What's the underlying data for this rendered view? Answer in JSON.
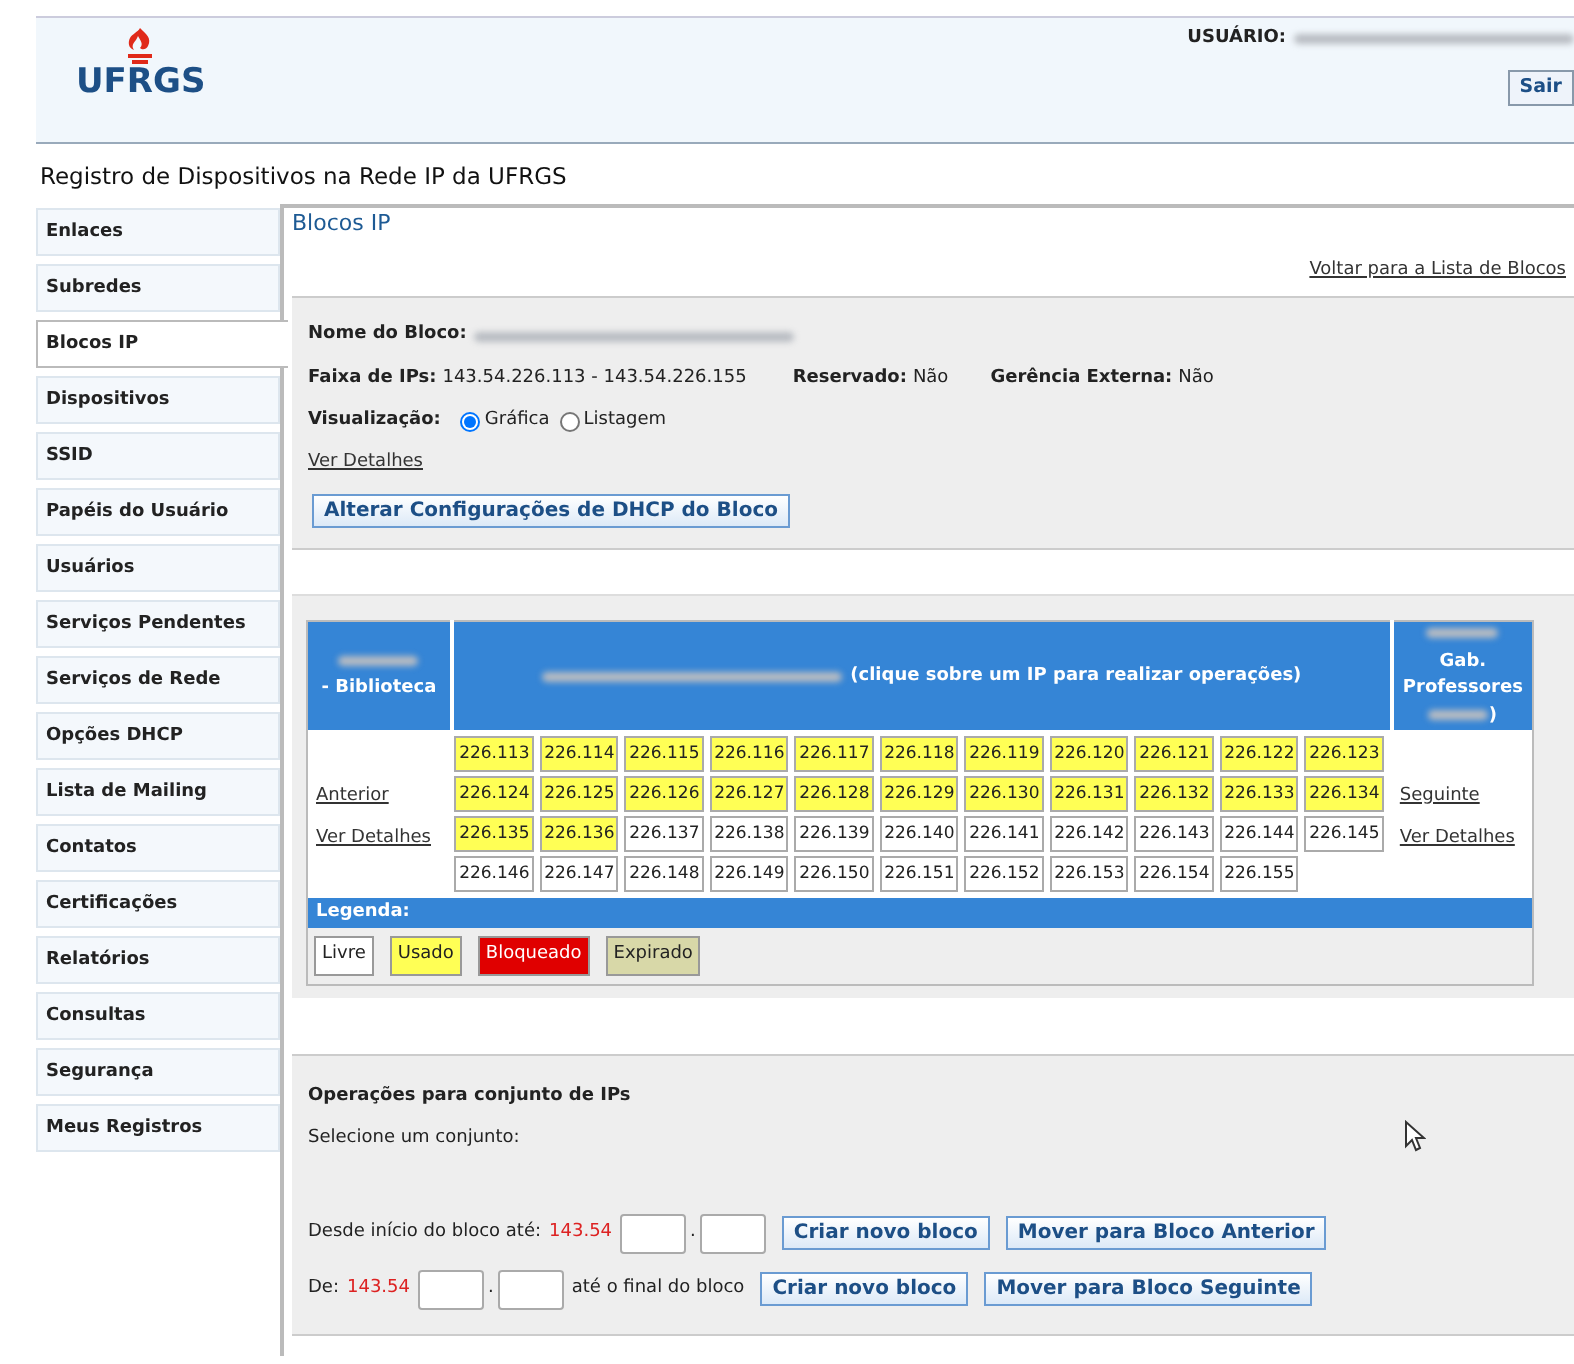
{
  "header": {
    "logo": "UFRGS",
    "user_label": "USUÁRIO:",
    "logout": "Sair"
  },
  "page_title": "Registro de Dispositivos na Rede IP da UFRGS",
  "sidebar": {
    "items": [
      {
        "label": "Enlaces",
        "selected": false
      },
      {
        "label": "Subredes",
        "selected": false
      },
      {
        "label": "Blocos IP",
        "selected": true
      },
      {
        "label": "Dispositivos",
        "selected": false
      },
      {
        "label": "SSID",
        "selected": false
      },
      {
        "label": "Papéis do Usuário",
        "selected": false
      },
      {
        "label": "Usuários",
        "selected": false
      },
      {
        "label": "Serviços Pendentes",
        "selected": false
      },
      {
        "label": "Serviços de Rede",
        "selected": false
      },
      {
        "label": "Opções DHCP",
        "selected": false
      },
      {
        "label": "Lista de Mailing",
        "selected": false
      },
      {
        "label": "Contatos",
        "selected": false
      },
      {
        "label": "Certificações",
        "selected": false
      },
      {
        "label": "Relatórios",
        "selected": false
      },
      {
        "label": "Consultas",
        "selected": false
      },
      {
        "label": "Segurança",
        "selected": false
      },
      {
        "label": "Meus Registros",
        "selected": false
      }
    ]
  },
  "section_title": "Blocos IP",
  "back_link": "Voltar para a Lista de Blocos",
  "block_info": {
    "name_label": "Nome do Bloco:",
    "range_label": "Faixa de IPs:",
    "range": "143.54.226.113 - 143.54.226.155",
    "reserved_label": "Reservado:",
    "reserved": "Não",
    "external_label": "Gerência Externa:",
    "external": "Não",
    "view_label": "Visualização:",
    "views": [
      {
        "label": "Gráfica",
        "selected": true
      },
      {
        "label": "Listagem",
        "selected": false
      }
    ],
    "details_link": "Ver Detalhes",
    "dhcp_button": "Alterar Configurações de DHCP do Bloco"
  },
  "ip_map": {
    "prev_block": {
      "suffix": "- Biblioteca",
      "link": "Anterior",
      "details": "Ver Detalhes"
    },
    "header_note": "(clique sobre um IP para realizar operações)",
    "next_block": {
      "suffix": "Gab. Professores",
      "closing": ")",
      "link": "Seguinte",
      "details": "Ver Detalhes"
    },
    "ips": [
      {
        "label": "226.113",
        "kind": "used"
      },
      {
        "label": "226.114",
        "kind": "used"
      },
      {
        "label": "226.115",
        "kind": "used"
      },
      {
        "label": "226.116",
        "kind": "used"
      },
      {
        "label": "226.117",
        "kind": "used"
      },
      {
        "label": "226.118",
        "kind": "used"
      },
      {
        "label": "226.119",
        "kind": "used"
      },
      {
        "label": "226.120",
        "kind": "used"
      },
      {
        "label": "226.121",
        "kind": "used"
      },
      {
        "label": "226.122",
        "kind": "used"
      },
      {
        "label": "226.123",
        "kind": "used"
      },
      {
        "label": "226.124",
        "kind": "used"
      },
      {
        "label": "226.125",
        "kind": "used"
      },
      {
        "label": "226.126",
        "kind": "used"
      },
      {
        "label": "226.127",
        "kind": "used"
      },
      {
        "label": "226.128",
        "kind": "used"
      },
      {
        "label": "226.129",
        "kind": "used"
      },
      {
        "label": "226.130",
        "kind": "used"
      },
      {
        "label": "226.131",
        "kind": "used"
      },
      {
        "label": "226.132",
        "kind": "used"
      },
      {
        "label": "226.133",
        "kind": "used"
      },
      {
        "label": "226.134",
        "kind": "used"
      },
      {
        "label": "226.135",
        "kind": "used"
      },
      {
        "label": "226.136",
        "kind": "used"
      },
      {
        "label": "226.137",
        "kind": "free"
      },
      {
        "label": "226.138",
        "kind": "free"
      },
      {
        "label": "226.139",
        "kind": "free"
      },
      {
        "label": "226.140",
        "kind": "free"
      },
      {
        "label": "226.141",
        "kind": "free"
      },
      {
        "label": "226.142",
        "kind": "free"
      },
      {
        "label": "226.143",
        "kind": "free"
      },
      {
        "label": "226.144",
        "kind": "free"
      },
      {
        "label": "226.145",
        "kind": "free"
      },
      {
        "label": "226.146",
        "kind": "free"
      },
      {
        "label": "226.147",
        "kind": "free"
      },
      {
        "label": "226.148",
        "kind": "free"
      },
      {
        "label": "226.149",
        "kind": "free"
      },
      {
        "label": "226.150",
        "kind": "free"
      },
      {
        "label": "226.151",
        "kind": "free"
      },
      {
        "label": "226.152",
        "kind": "free"
      },
      {
        "label": "226.153",
        "kind": "free"
      },
      {
        "label": "226.154",
        "kind": "free"
      },
      {
        "label": "226.155",
        "kind": "free"
      }
    ],
    "legend_title": "Legenda:",
    "legend": [
      {
        "label": "Livre",
        "kind": "free"
      },
      {
        "label": "Usado",
        "kind": "used"
      },
      {
        "label": "Bloqueado",
        "kind": "blocked"
      },
      {
        "label": "Expirado",
        "kind": "expired"
      }
    ]
  },
  "operations": {
    "title": "Operações para conjunto de IPs",
    "subtitle": "Selecione um conjunto:",
    "rows": [
      {
        "before": "Desde início do bloco até:",
        "prefix": "143.54",
        "dot": ".",
        "after": "",
        "buttons": [
          "Criar novo bloco",
          "Mover para Bloco Anterior"
        ]
      },
      {
        "before": "De:",
        "prefix": "143.54",
        "dot": ".",
        "after": "até o final do bloco",
        "buttons": [
          "Criar novo bloco",
          "Mover para Bloco Seguinte"
        ]
      }
    ]
  }
}
